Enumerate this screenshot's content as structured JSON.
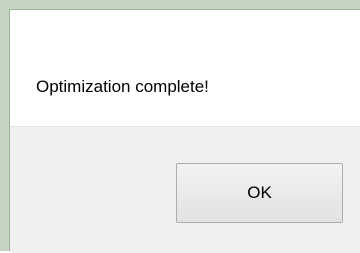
{
  "dialog": {
    "message": "Optimization complete!",
    "ok_label": "OK"
  },
  "colors": {
    "frame": "#c4d6c2",
    "content_background": "#ffffff",
    "button_bar_background": "#f0f0f0",
    "button_border": "#adadad"
  }
}
